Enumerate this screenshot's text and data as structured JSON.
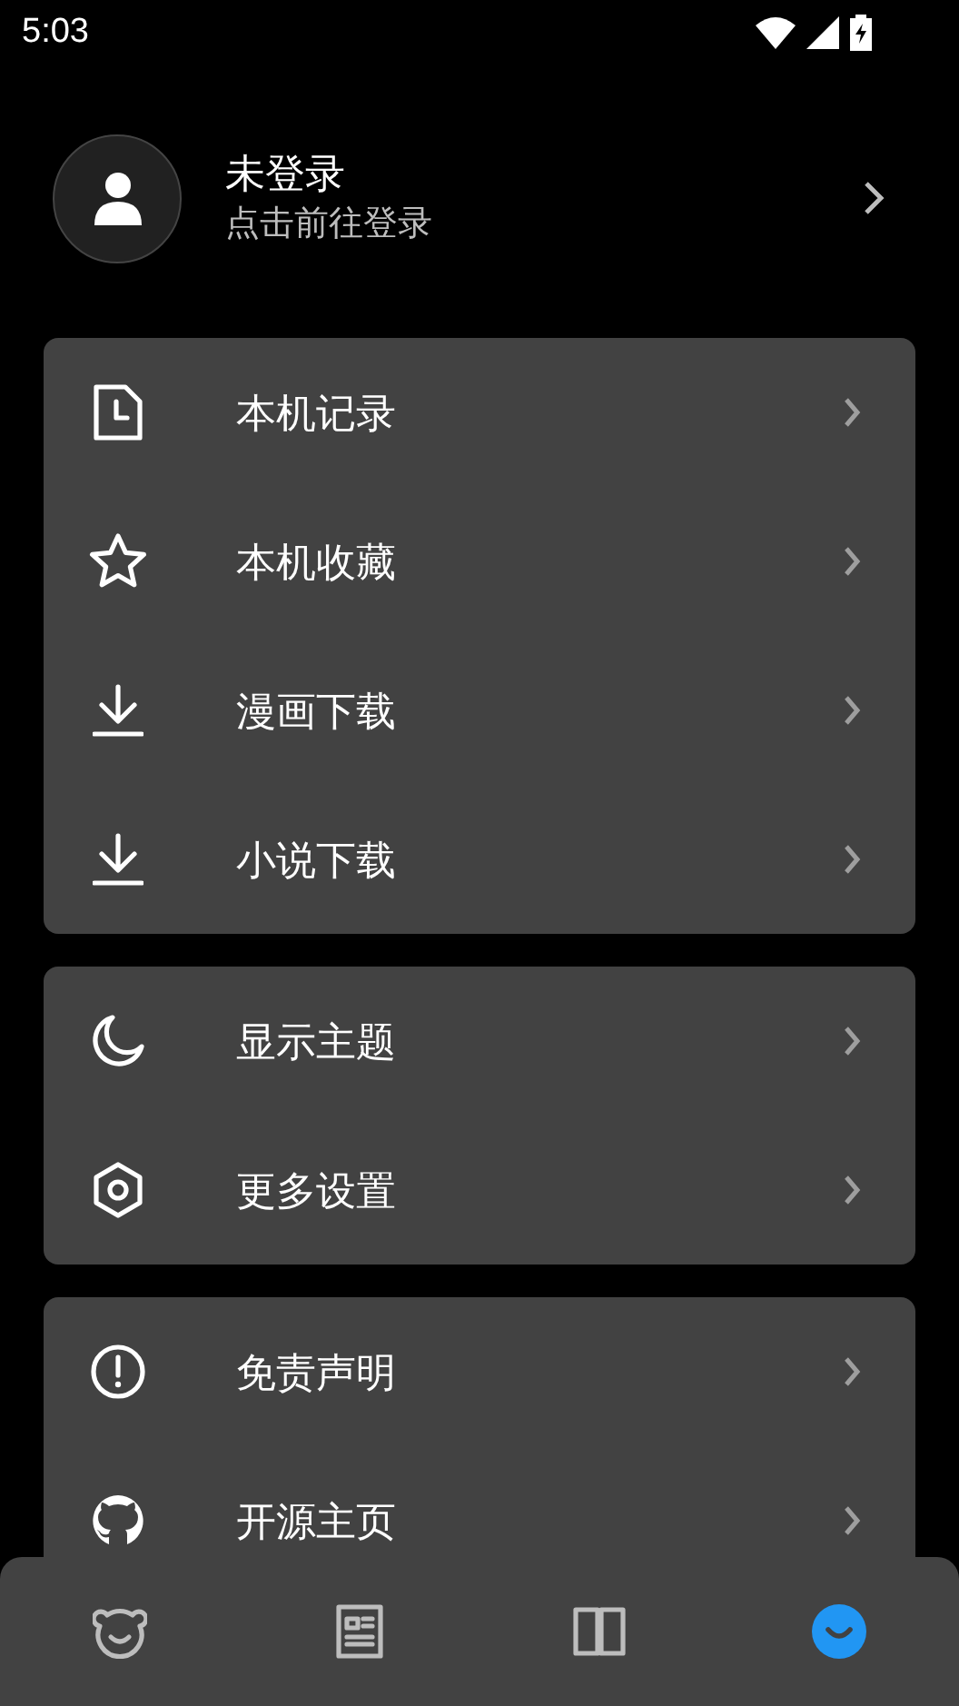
{
  "status_bar": {
    "time": "5:03"
  },
  "profile": {
    "name": "未登录",
    "subtitle": "点击前往登录"
  },
  "groups": [
    {
      "items": [
        {
          "kind": "history",
          "label": "本机记录"
        },
        {
          "kind": "star",
          "label": "本机收藏"
        },
        {
          "kind": "download",
          "label": "漫画下载"
        },
        {
          "kind": "download",
          "label": "小说下载"
        }
      ]
    },
    {
      "items": [
        {
          "kind": "moon",
          "label": "显示主题"
        },
        {
          "kind": "settings",
          "label": "更多设置"
        }
      ]
    },
    {
      "items": [
        {
          "kind": "alert",
          "label": "免责声明"
        },
        {
          "kind": "github",
          "label": "开源主页"
        }
      ]
    }
  ],
  "bottom_nav": [
    {
      "kind": "bear",
      "selected": false
    },
    {
      "kind": "news",
      "selected": false
    },
    {
      "kind": "book",
      "selected": false
    },
    {
      "kind": "smile",
      "selected": true
    }
  ]
}
